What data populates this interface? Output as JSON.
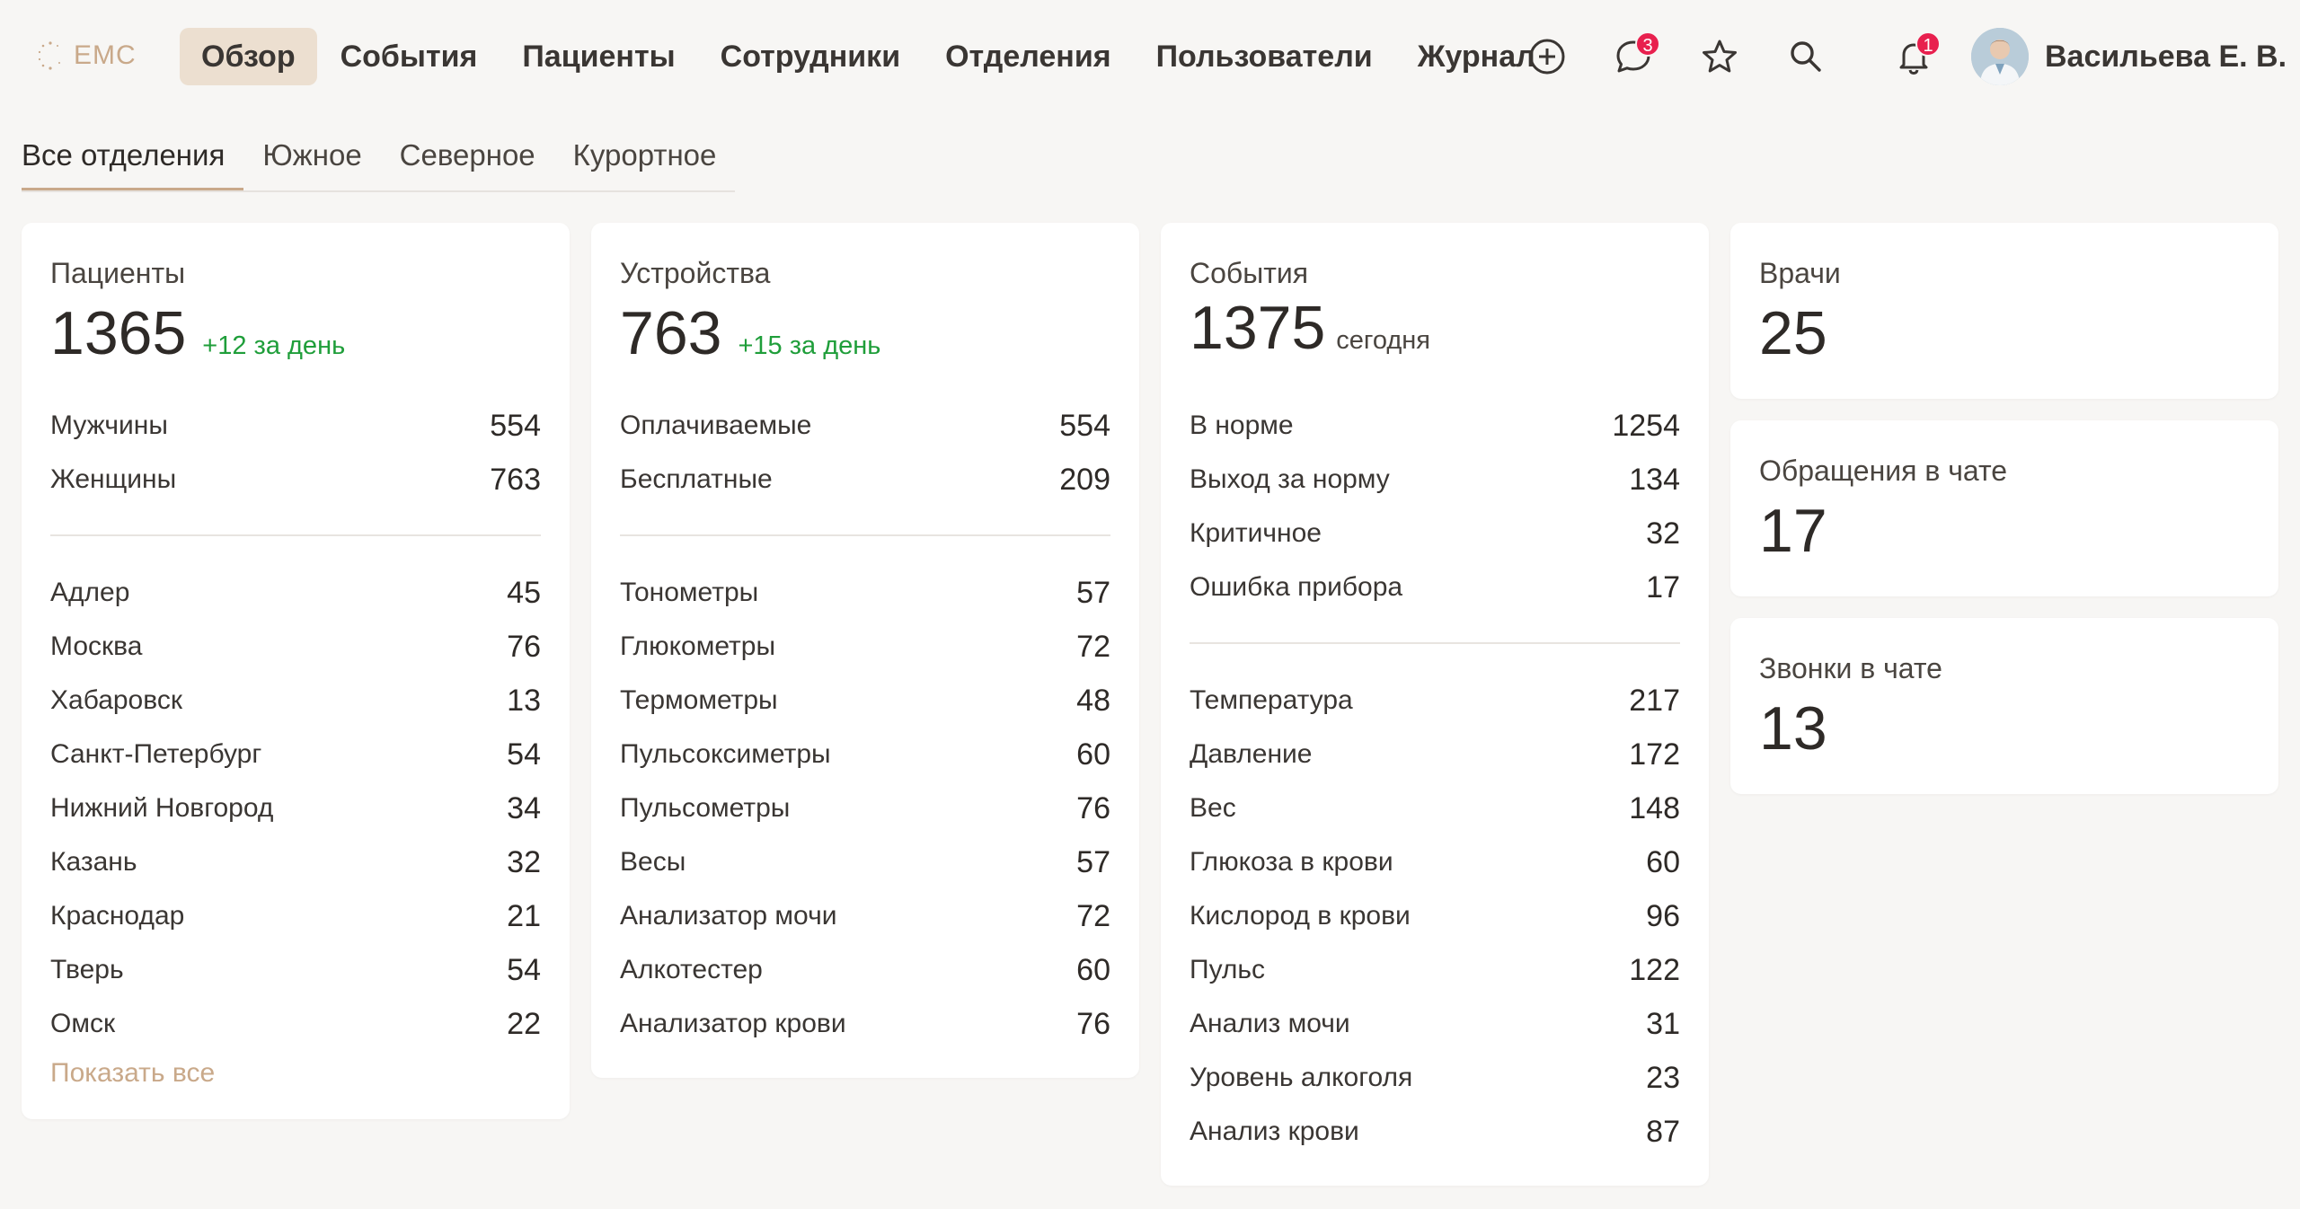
{
  "logo": {
    "text": "EMC"
  },
  "nav": [
    {
      "label": "Обзор",
      "active": true
    },
    {
      "label": "События"
    },
    {
      "label": "Пациенты"
    },
    {
      "label": "Сотрудники"
    },
    {
      "label": "Отделения"
    },
    {
      "label": "Пользователи"
    },
    {
      "label": "Журнал"
    }
  ],
  "header_icons": {
    "add": "plus-circle-icon",
    "chat": "chat-icon",
    "chat_badge": "3",
    "favorites": "star-icon",
    "search": "search-icon",
    "notifications": "bell-icon",
    "notifications_badge": "1"
  },
  "user": {
    "name": "Васильева Е. В."
  },
  "tabs": [
    {
      "label": "Все отделения",
      "active": true
    },
    {
      "label": "Южное"
    },
    {
      "label": "Северное"
    },
    {
      "label": "Курортное"
    }
  ],
  "patients": {
    "title": "Пациенты",
    "total": "1365",
    "delta": "+12 за день",
    "gender": [
      {
        "label": "Мужчины",
        "value": "554"
      },
      {
        "label": "Женщины",
        "value": "763"
      }
    ],
    "cities": [
      {
        "label": "Адлер",
        "value": "45"
      },
      {
        "label": "Москва",
        "value": "76"
      },
      {
        "label": "Хабаровск",
        "value": "13"
      },
      {
        "label": "Санкт-Петербург",
        "value": "54"
      },
      {
        "label": "Нижний Новгород",
        "value": "34"
      },
      {
        "label": "Казань",
        "value": "32"
      },
      {
        "label": "Краснодар",
        "value": "21"
      },
      {
        "label": "Тверь",
        "value": "54"
      },
      {
        "label": "Омск",
        "value": "22"
      }
    ],
    "show_all": "Показать все"
  },
  "devices": {
    "title": "Устройства",
    "total": "763",
    "delta": "+15 за день",
    "billing": [
      {
        "label": "Оплачиваемые",
        "value": "554"
      },
      {
        "label": "Бесплатные",
        "value": "209"
      }
    ],
    "types": [
      {
        "label": "Тонометры",
        "value": "57"
      },
      {
        "label": "Глюкометры",
        "value": "72"
      },
      {
        "label": "Термометры",
        "value": "48"
      },
      {
        "label": "Пульсоксиметры",
        "value": "60"
      },
      {
        "label": "Пульсометры",
        "value": "76"
      },
      {
        "label": "Весы",
        "value": "57"
      },
      {
        "label": "Анализатор мочи",
        "value": "72"
      },
      {
        "label": "Алкотестер",
        "value": "60"
      },
      {
        "label": "Анализатор крови",
        "value": "76"
      }
    ]
  },
  "events": {
    "title": "События",
    "total": "1375",
    "today": "сегодня",
    "status": [
      {
        "label": "В норме",
        "value": "1254"
      },
      {
        "label": "Выход за норму",
        "value": "134"
      },
      {
        "label": "Критичное",
        "value": "32"
      },
      {
        "label": "Ошибка прибора",
        "value": "17"
      }
    ],
    "types": [
      {
        "label": "Температура",
        "value": "217"
      },
      {
        "label": "Давление",
        "value": "172"
      },
      {
        "label": "Вес",
        "value": "148"
      },
      {
        "label": "Глюкоза в крови",
        "value": "60"
      },
      {
        "label": "Кислород в крови",
        "value": "96"
      },
      {
        "label": "Пульс",
        "value": "122"
      },
      {
        "label": "Анализ мочи",
        "value": "31"
      },
      {
        "label": "Уровень алкоголя",
        "value": "23"
      },
      {
        "label": "Анализ крови",
        "value": "87"
      }
    ]
  },
  "doctors": {
    "title": "Врачи",
    "value": "25"
  },
  "chat_requests": {
    "title": "Обращения в чате",
    "value": "17"
  },
  "chat_calls": {
    "title": "Звонки в чате",
    "value": "13"
  },
  "colors": {
    "accent": "#c9a98a",
    "active_nav_bg": "#ecdfd0",
    "positive": "#1f9e3a",
    "badge": "#e8204e",
    "background": "#f7f6f4"
  }
}
